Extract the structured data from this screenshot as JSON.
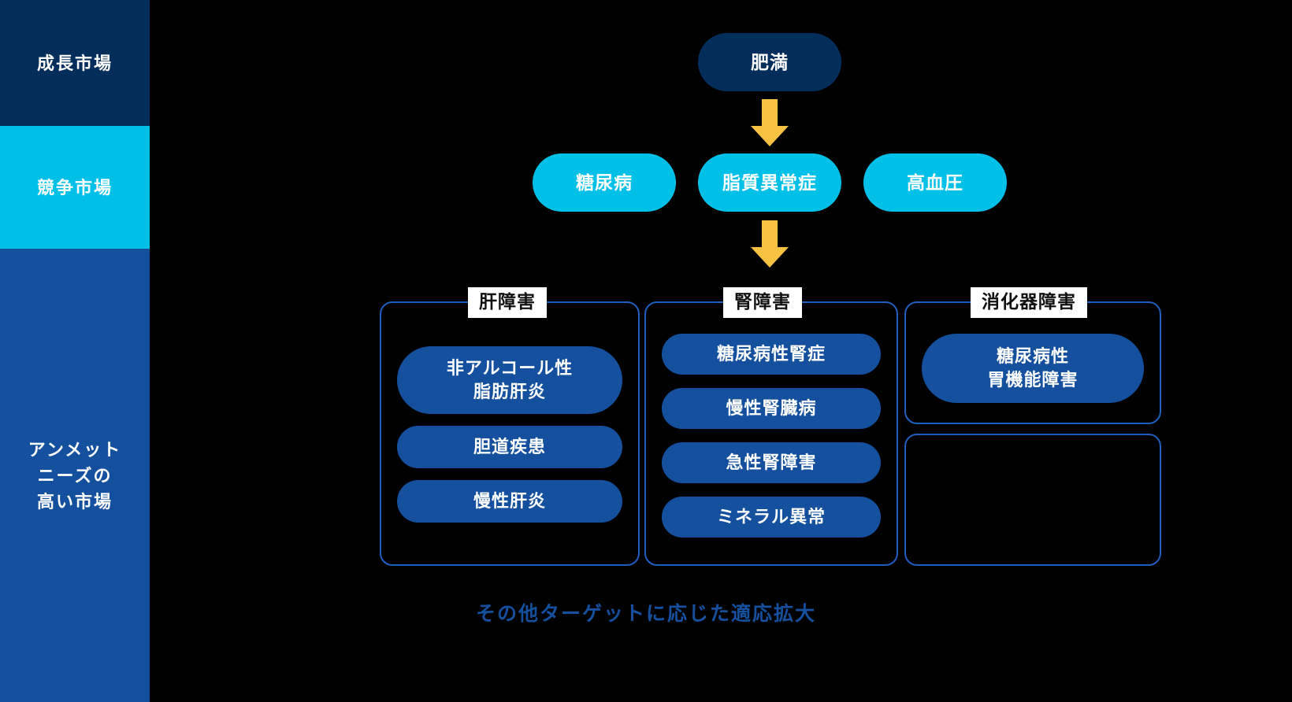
{
  "colors": {
    "background": "#000000",
    "dark_navy": "#032E5C",
    "cyan": "#00C0E8",
    "mid_blue": "#14509E",
    "border_blue": "#1F5FBF",
    "arrow_yellow": "#F7C242",
    "white": "#FFFFFF",
    "chip_text": "#111111"
  },
  "market_bands": [
    {
      "id": "growth-market",
      "label": "成長市場"
    },
    {
      "id": "competitive-market",
      "label": "競争市場"
    },
    {
      "id": "unmet-needs-market",
      "label": "アンメット\nニーズの\n高い市場"
    }
  ],
  "market_band_lines": {
    "unmet_line1": "アンメット",
    "unmet_line2": "ニーズの",
    "unmet_line3": "高い市場"
  },
  "top_node": {
    "label": "肥満"
  },
  "middle_nodes": [
    {
      "id": "diabetes",
      "label": "糖尿病"
    },
    {
      "id": "dyslipidemia",
      "label": "脂質異常症"
    },
    {
      "id": "hypertension",
      "label": "高血圧"
    }
  ],
  "arrows": [
    {
      "id": "arrow-obesity-to-dyslipidemia",
      "direction": "down",
      "color": "#F7C242"
    },
    {
      "id": "arrow-dyslipidemia-to-kidney",
      "direction": "down",
      "color": "#F7C242"
    }
  ],
  "groups": [
    {
      "id": "liver-disorder",
      "title": "肝障害",
      "items": [
        {
          "line1": "非アルコール性",
          "line2": "脂肪肝炎"
        },
        {
          "line1": "胆道疾患",
          "line2": ""
        },
        {
          "line1": "慢性肝炎",
          "line2": ""
        }
      ]
    },
    {
      "id": "kidney-disorder",
      "title": "腎障害",
      "items": [
        {
          "line1": "糖尿病性腎症",
          "line2": ""
        },
        {
          "line1": "慢性腎臓病",
          "line2": ""
        },
        {
          "line1": "急性腎障害",
          "line2": ""
        },
        {
          "line1": "ミネラル異常",
          "line2": ""
        }
      ]
    },
    {
      "id": "gastrointestinal-disorder",
      "title": "消化器障害",
      "items": [
        {
          "line1": "糖尿病性",
          "line2": "胃機能障害"
        }
      ]
    },
    {
      "id": "empty-expansion-box",
      "title": "",
      "items": []
    }
  ],
  "caption": {
    "text": "その他ターゲットに応じた適応拡大"
  }
}
